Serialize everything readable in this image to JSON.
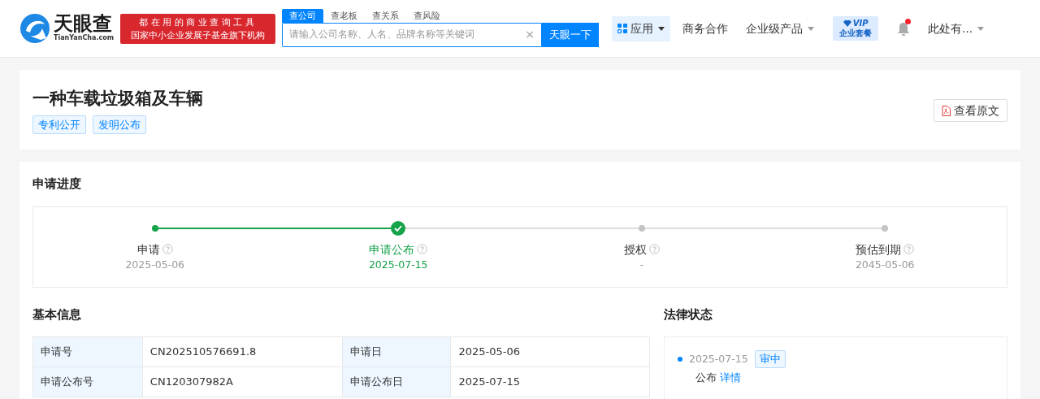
{
  "header": {
    "logo": {
      "name": "天眼查",
      "domain": "TianYanCha.com"
    },
    "slogan": [
      "都在用的商业查询工具",
      "国家中小企业发展子基金旗下机构"
    ],
    "search": {
      "tabs": [
        {
          "label": "查公司",
          "selected": true
        },
        {
          "label": "查老板",
          "selected": false
        },
        {
          "label": "查关系",
          "selected": false
        },
        {
          "label": "查风险",
          "selected": false
        }
      ],
      "placeholder": "请输入公司名称、人名、品牌名称等关键词",
      "clear": "×",
      "button": "天眼一下"
    },
    "nav": [
      {
        "kind": "apps",
        "label": "应用"
      },
      {
        "kind": "link",
        "label": "商务合作"
      },
      {
        "kind": "dropdown",
        "label": "企业级产品"
      },
      {
        "kind": "vip",
        "label": "VIP",
        "sublabel": "企业套餐"
      },
      {
        "kind": "bell",
        "unread": true
      },
      {
        "kind": "dropdown",
        "label": "此处有..."
      }
    ]
  },
  "patent": {
    "title": "一种车载垃圾箱及车辆",
    "tags": [
      "专利公开",
      "发明公布"
    ],
    "view_button": "查看原文"
  },
  "progress": {
    "title": "申请进度",
    "steps": [
      {
        "label": "申请",
        "date": "2025-05-06",
        "kind": "done"
      },
      {
        "label": "申请公布",
        "date": "2025-07-15",
        "kind": "current"
      },
      {
        "label": "授权",
        "date": "-",
        "kind": "pending"
      },
      {
        "label": "预估到期",
        "date": "2045-05-06",
        "kind": "pending"
      }
    ]
  },
  "basic_info": {
    "title": "基本信息",
    "rows": [
      [
        {
          "label": "申请号",
          "value": "CN202510576691.8"
        },
        {
          "label": "申请日",
          "value": "2025-05-06"
        }
      ],
      [
        {
          "label": "申请公布号",
          "value": "CN120307982A"
        },
        {
          "label": "申请公布日",
          "value": "2025-07-15"
        }
      ]
    ]
  },
  "legal_status": {
    "title": "法律状态",
    "events": [
      {
        "date": "2025-07-15",
        "tag": "审中",
        "text": "公布",
        "link": "详情"
      }
    ]
  }
}
